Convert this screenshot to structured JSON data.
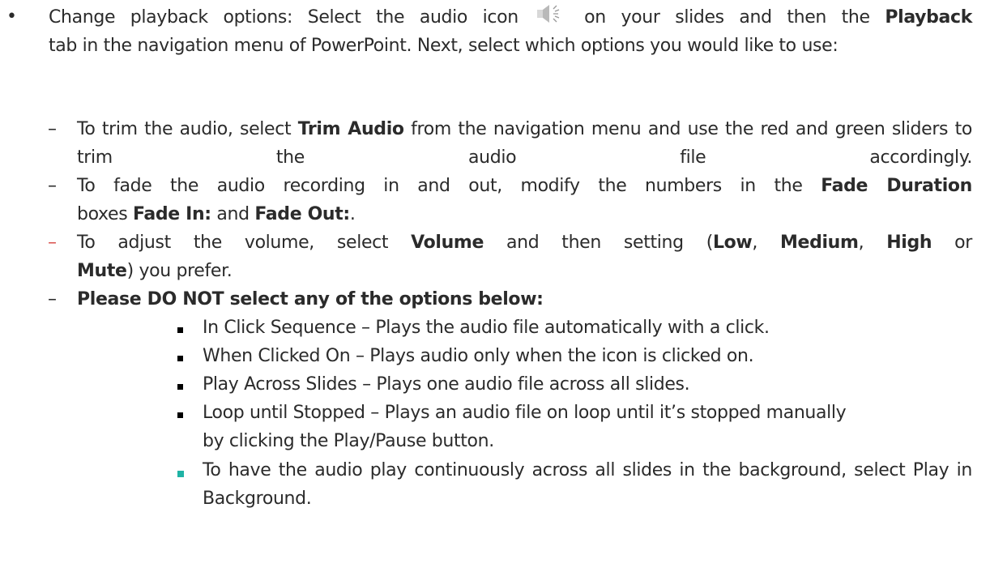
{
  "main_bullet": {
    "lead": "Change playback options:  Select the audio icon",
    "after_icon": "on your slides and then the",
    "playback_tab": "Playback",
    "rest": "tab in the navigation menu of PowerPoint. Next, select which options you would like to use:",
    "icon": "speaker-icon"
  },
  "sub_items": [
    {
      "t1": "To trim the audio, select",
      "b1": "Trim Audio",
      "t2": "from the navigation menu and use the red and green sliders to trim the audio file accordingly."
    },
    {
      "t1": "To fade the audio recording in and out, modify the numbers in the",
      "b1": "Fade Duration",
      "t2": "boxes",
      "b2": "Fade In:",
      "t3": "and",
      "b3": "Fade Out:",
      "t4": "."
    },
    {
      "t1": "To adjust the volume, select",
      "b1": "Volume",
      "t2": "and then setting (",
      "b2": "Low",
      "t3": ",",
      "b3": "Medium",
      "t4": ",",
      "b4": "High",
      "t5": "or",
      "b5": "Mute",
      "t6": ") you prefer."
    },
    {
      "b1": "Please DO NOT select any of the options below:"
    }
  ],
  "options": [
    "In Click Sequence – Plays the audio file automatically with a click.",
    "When Clicked On – Plays audio only when the icon is clicked on.",
    "Play Across Slides – Plays one audio file across all slides.",
    "Loop until Stopped – Plays an audio file on loop until it’s stopped manually by clicking the Play/Pause button."
  ],
  "background_item": "To have the audio play continuously across all slides in the background, select Play in Background.",
  "colors": {
    "dash_accent": "#d9534f",
    "teal_bullet": "#1fb3a5",
    "text": "#2b2b2b"
  }
}
